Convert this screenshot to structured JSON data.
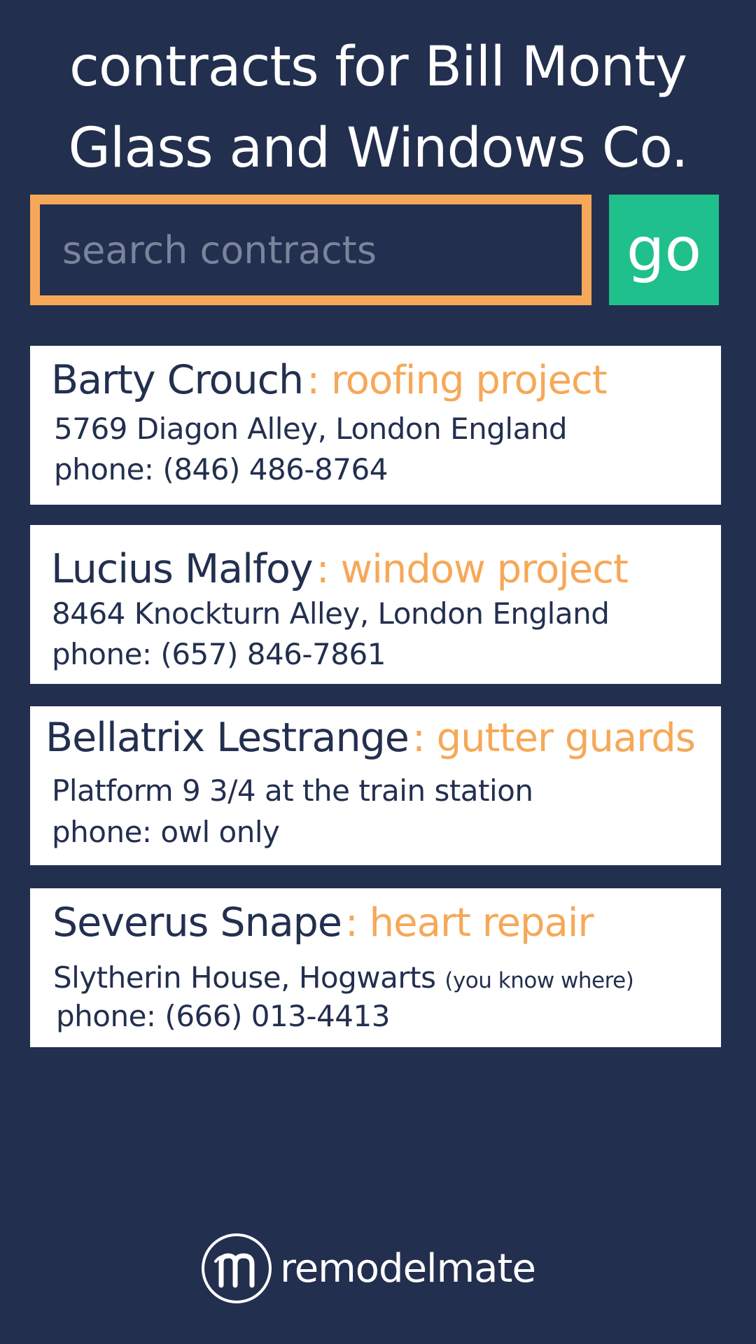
{
  "header": {
    "title_line1": "contracts for Bill Monty",
    "title_line2": "Glass and Windows Co."
  },
  "search": {
    "placeholder": "search contracts",
    "value": "",
    "go_label": "go"
  },
  "contracts": [
    {
      "name": "Barty Crouch",
      "project": ": roofing project",
      "address": "5769 Diagon Alley, London England",
      "address_note": "",
      "phone": "phone: (846) 486-8764"
    },
    {
      "name": "Lucius Malfoy",
      "project": ": window project",
      "address": "8464 Knockturn Alley, London England",
      "address_note": "",
      "phone": "phone: (657) 846-7861"
    },
    {
      "name": "Bellatrix Lestrange",
      "project": ": gutter guards",
      "address": "Platform 9 3/4 at the train station",
      "address_note": "",
      "phone": "phone: owl only"
    },
    {
      "name": "Severus Snape",
      "project": ": heart repair",
      "address": "Slytherin House, Hogwarts",
      "address_note": "(you know where)",
      "phone": "phone: (666) 013-4413"
    }
  ],
  "brand": {
    "name": "remodelmate",
    "logo_icon": "remodelmate-logo-icon"
  },
  "colors": {
    "background": "#232f4f",
    "accent_orange": "#f6a858",
    "go_green": "#1fc08c",
    "card": "#ffffff"
  }
}
